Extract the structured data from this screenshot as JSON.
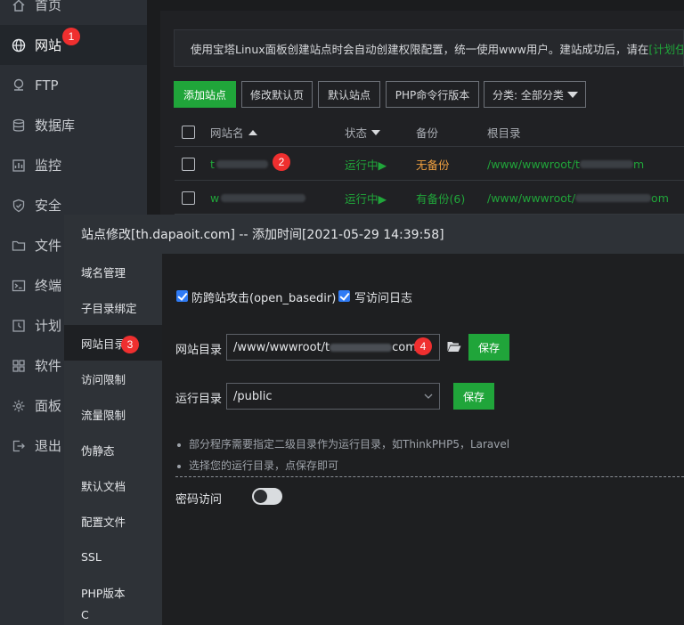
{
  "sidebar": {
    "items": [
      {
        "label": "首页",
        "icon": "home-icon"
      },
      {
        "label": "网站",
        "icon": "globe-icon",
        "active": true
      },
      {
        "label": "FTP",
        "icon": "ftp-icon"
      },
      {
        "label": "数据库",
        "icon": "database-icon"
      },
      {
        "label": "监控",
        "icon": "monitor-icon"
      },
      {
        "label": "安全",
        "icon": "shield-icon"
      },
      {
        "label": "文件",
        "icon": "folder-icon"
      },
      {
        "label": "终端",
        "icon": "terminal-icon"
      },
      {
        "label": "计划",
        "icon": "clock-icon"
      },
      {
        "label": "软件",
        "icon": "apps-icon"
      },
      {
        "label": "面板",
        "icon": "gear-icon"
      },
      {
        "label": "退出",
        "icon": "logout-icon"
      }
    ],
    "badge": "1"
  },
  "notice": {
    "text": "使用宝塔Linux面板创建站点时会自动创建权限配置，统一使用www用户。建站成功后，请在",
    "link": "[计划任务"
  },
  "toolbar": {
    "add_site": "添加站点",
    "edit_default_page": "修改默认页",
    "default_site": "默认站点",
    "php_cli_version": "PHP命令行版本",
    "category_select": "分类: 全部分类"
  },
  "table": {
    "headers": {
      "name": "网站名",
      "status": "状态",
      "backup": "备份",
      "root": "根目录"
    },
    "rows": [
      {
        "name": "t",
        "status": "运行中▶",
        "backup": "无备份",
        "root_prefix": "/www/wwwroot/t",
        "root_suffix": "m",
        "badge": "2"
      },
      {
        "name": "w",
        "status": "运行中▶",
        "backup": "有备份(6)",
        "root_prefix": "/www/wwwroot/",
        "root_suffix": "om",
        "badge": ""
      }
    ]
  },
  "modal": {
    "title": "站点修改[th.dapaoit.com] -- 添加时间[2021-05-29 14:39:58]",
    "menu": [
      {
        "label": "域名管理"
      },
      {
        "label": "子目录绑定"
      },
      {
        "label": "网站目录",
        "active": true,
        "badge": "3"
      },
      {
        "label": "访问限制"
      },
      {
        "label": "流量限制"
      },
      {
        "label": "伪静态"
      },
      {
        "label": "默认文档"
      },
      {
        "label": "配置文件"
      },
      {
        "label": "SSL"
      },
      {
        "label": "PHP版本"
      },
      {
        "label": "C"
      }
    ],
    "anti_xss_label": "防跨站攻击(open_basedir)",
    "access_log_label": "写访问日志",
    "site_dir_label": "网站目录",
    "site_dir_value": "/www/wwwroot/t",
    "site_dir_suffix": "com",
    "site_dir_badge": "4",
    "run_dir_label": "运行目录",
    "run_dir_value": "/public",
    "save_label": "保存",
    "tips": [
      "部分程序需要指定二级目录作为运行目录，如ThinkPHP5，Laravel",
      "选择您的运行目录，点保存即可"
    ],
    "password_access_label": "密码访问"
  },
  "colors": {
    "accent": "#20a53a",
    "badge": "#ef2f2f",
    "checkbox": "#2f7bf5",
    "backup_none": "#f0a040"
  }
}
